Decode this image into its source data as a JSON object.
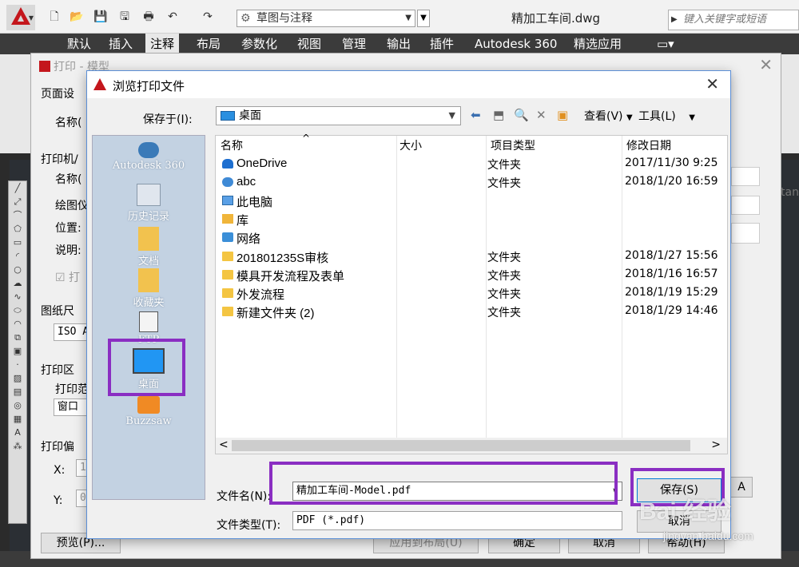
{
  "app": {
    "document_title": "精加工车间.dwg",
    "workspace": "草图与注释",
    "search_placeholder": "键入关键字或短语",
    "ribbon_tabs": [
      "默认",
      "插入",
      "注释",
      "布局",
      "参数化",
      "视图",
      "管理",
      "输出",
      "插件",
      "Autodesk 360",
      "精选应用"
    ],
    "active_tab": "注释",
    "brand_color": "#c4161c"
  },
  "print_dialog": {
    "title": "打印 - 模型",
    "labels": {
      "page_setup": "页面设",
      "name1": "名称(",
      "printer": "打印机/",
      "name2": "名称(",
      "plotter": "绘图仪",
      "location": "位置:",
      "description": "说明:",
      "print_to_file": "打",
      "paper_size": "图纸尺",
      "paper_value": "ISO A",
      "print_area": "打印区",
      "print_range": "打印范",
      "window_value": "窗口",
      "print_offset": "打印偏",
      "x": "X:",
      "y": "Y:",
      "x_value": "1",
      "y_value": "0",
      "right_text": "tan",
      "a_button": "A"
    },
    "buttons": {
      "preview": "预览(P)...",
      "apply_layout": "应用到布局(U)",
      "ok": "确定",
      "cancel": "取消",
      "help": "帮助(H)"
    }
  },
  "browse_dialog": {
    "title": "浏览打印文件",
    "save_in_label": "保存于(I):",
    "save_in_value": "桌面",
    "view_menu": "查看(V)",
    "tools_menu": "工具(L)",
    "places": [
      {
        "label": "Autodesk 360",
        "icon": "cloud-icon"
      },
      {
        "label": "历史记录",
        "icon": "history-icon"
      },
      {
        "label": "文档",
        "icon": "documents-icon"
      },
      {
        "label": "收藏夹",
        "icon": "favorites-icon"
      },
      {
        "label": "FTP",
        "icon": "ftp-icon"
      },
      {
        "label": "桌面",
        "icon": "desktop-icon"
      },
      {
        "label": "Buzzsaw",
        "icon": "buzzsaw-icon"
      }
    ],
    "columns": [
      "名称",
      "大小",
      "项目类型",
      "修改日期"
    ],
    "files": [
      {
        "name": "OneDrive",
        "type": "文件夹",
        "date": "2017/11/30 9:25",
        "icon": "cloud"
      },
      {
        "name": "abc",
        "type": "文件夹",
        "date": "2018/1/20 16:59",
        "icon": "user"
      },
      {
        "name": "此电脑",
        "type": "",
        "date": "",
        "icon": "pc"
      },
      {
        "name": "库",
        "type": "",
        "date": "",
        "icon": "lib"
      },
      {
        "name": "网络",
        "type": "",
        "date": "",
        "icon": "net"
      },
      {
        "name": "201801235S审核",
        "type": "文件夹",
        "date": "2018/1/27 15:56",
        "icon": "folder"
      },
      {
        "name": "模具开发流程及表单",
        "type": "文件夹",
        "date": "2018/1/16 16:57",
        "icon": "folder"
      },
      {
        "name": "外发流程",
        "type": "文件夹",
        "date": "2018/1/19 15:29",
        "icon": "folder"
      },
      {
        "name": "新建文件夹 (2)",
        "type": "文件夹",
        "date": "2018/1/29 14:46",
        "icon": "folder"
      }
    ],
    "filename_label": "文件名(N):",
    "filename_value": "精加工车间-Model.pdf",
    "filetype_label": "文件类型(T):",
    "filetype_value": "PDF (*.pdf)",
    "save_button": "保存(S)",
    "cancel_button": "取消"
  },
  "watermark": {
    "brand": "Bai 经验",
    "domain": "jingyan.baidu.com"
  },
  "highlight_color": "#8a2ec2"
}
